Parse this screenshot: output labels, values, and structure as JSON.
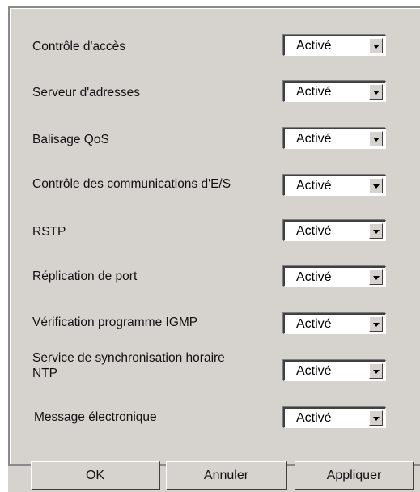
{
  "settings": [
    {
      "label": "Contrôle d'accès",
      "value": "Activé"
    },
    {
      "label": "Serveur d'adresses",
      "value": "Activé"
    },
    {
      "label": "Balisage QoS",
      "value": "Activé"
    },
    {
      "label": "Contrôle des communications d'E/S",
      "value": "Activé"
    },
    {
      "label": "RSTP",
      "value": "Activé"
    },
    {
      "label": "Réplication de port",
      "value": "Activé"
    },
    {
      "label": "Vérification programme IGMP",
      "value": "Activé"
    },
    {
      "label": "Service de synchronisation horaire NTP",
      "value": "Activé"
    },
    {
      "label": "Message électronique",
      "value": "Activé"
    }
  ],
  "buttons": {
    "ok": "OK",
    "cancel": "Annuler",
    "apply": "Appliquer"
  },
  "colors": {
    "panel_background": "#d6d3ce",
    "field_background": "#ffffff"
  },
  "icons": {
    "dropdown": "chevron-down-icon"
  }
}
